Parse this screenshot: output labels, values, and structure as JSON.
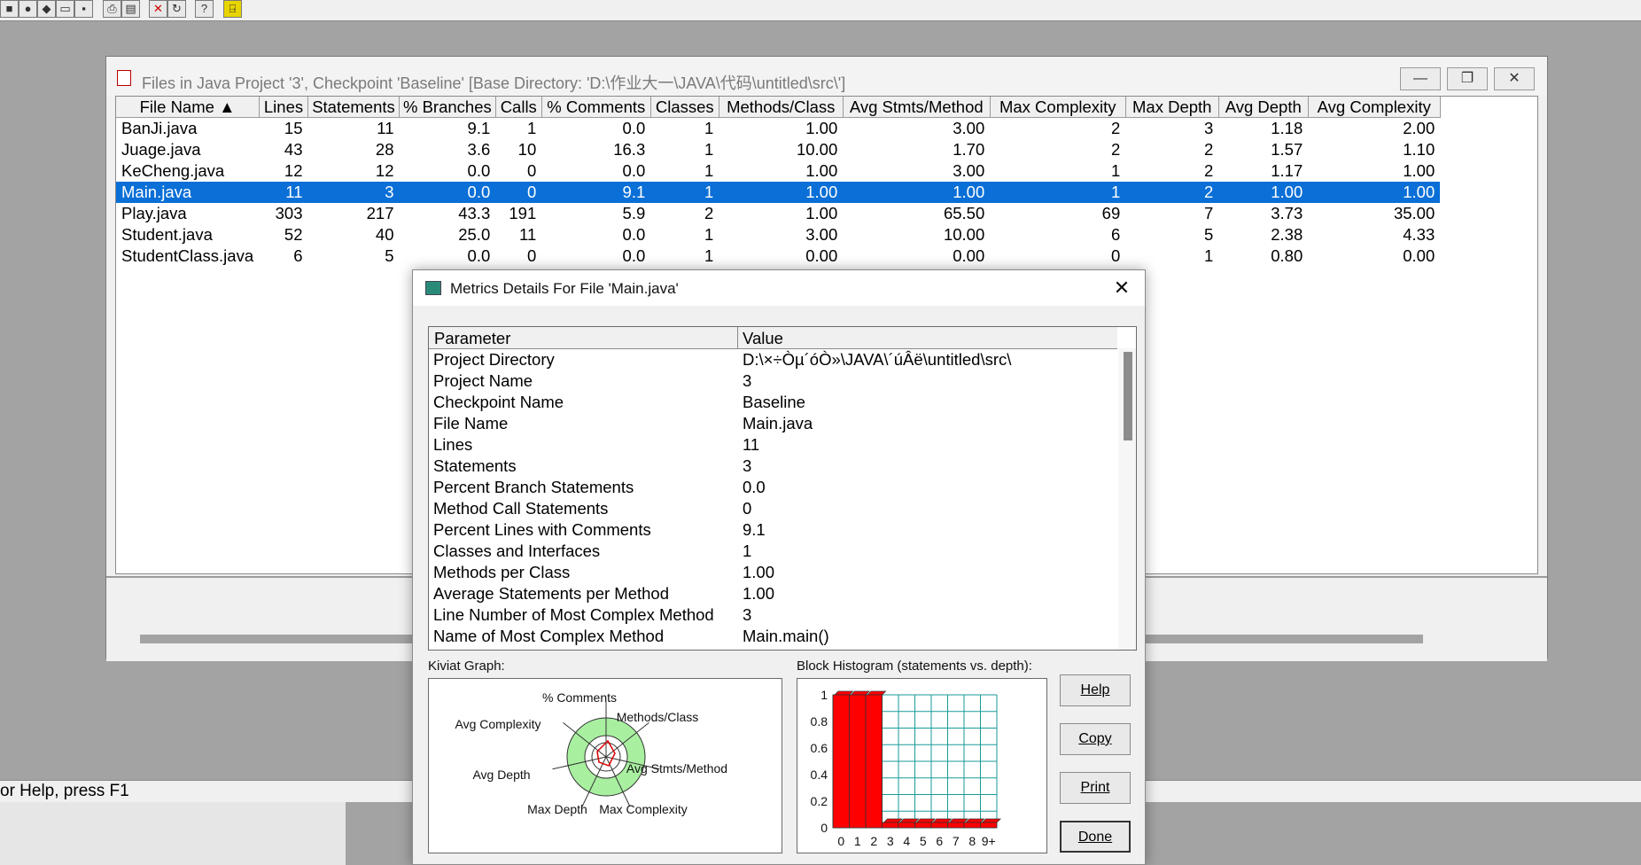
{
  "main_window": {
    "title": "Files in Java Project '3', Checkpoint 'Baseline'  [Base Directory: 'D:\\作业大一\\JAVA\\代码\\untitled\\src\\']",
    "columns": [
      "File Name",
      "Lines",
      "Statements",
      "% Branches",
      "Calls",
      "% Comments",
      "Classes",
      "Methods/Class",
      "Avg Stmts/Method",
      "Max Complexity",
      "Max Depth",
      "Avg Depth",
      "Avg Complexity"
    ],
    "rows": [
      [
        "BanJi.java",
        "15",
        "11",
        "9.1",
        "1",
        "0.0",
        "1",
        "1.00",
        "3.00",
        "2",
        "3",
        "1.18",
        "2.00"
      ],
      [
        "Juage.java",
        "43",
        "28",
        "3.6",
        "10",
        "16.3",
        "1",
        "10.00",
        "1.70",
        "2",
        "2",
        "1.57",
        "1.10"
      ],
      [
        "KeCheng.java",
        "12",
        "12",
        "0.0",
        "0",
        "0.0",
        "1",
        "1.00",
        "3.00",
        "1",
        "2",
        "1.17",
        "1.00"
      ],
      [
        "Main.java",
        "11",
        "3",
        "0.0",
        "0",
        "9.1",
        "1",
        "1.00",
        "1.00",
        "1",
        "2",
        "1.00",
        "1.00"
      ],
      [
        "Play.java",
        "303",
        "217",
        "43.3",
        "191",
        "5.9",
        "2",
        "1.00",
        "65.50",
        "69",
        "7",
        "3.73",
        "35.00"
      ],
      [
        "Student.java",
        "52",
        "40",
        "25.0",
        "11",
        "0.0",
        "1",
        "3.00",
        "10.00",
        "6",
        "5",
        "2.38",
        "4.33"
      ],
      [
        "StudentClass.java",
        "6",
        "5",
        "0.0",
        "0",
        "0.0",
        "1",
        "0.00",
        "0.00",
        "0",
        "1",
        "0.80",
        "0.00"
      ]
    ],
    "selected_row": 3
  },
  "status_bar": {
    "text": "or Help, press F1"
  },
  "dialog": {
    "title": "Metrics Details For File 'Main.java'",
    "close_label": "✕",
    "param_header": "Parameter",
    "value_header": "Value",
    "params": [
      {
        "name": "Project Directory",
        "value": "D:\\×÷Òµ´óÒ»\\JAVA\\´úÂë\\untitled\\src\\"
      },
      {
        "name": "Project Name",
        "value": "3"
      },
      {
        "name": "Checkpoint Name",
        "value": "Baseline"
      },
      {
        "name": "File Name",
        "value": "Main.java"
      },
      {
        "name": "Lines",
        "value": "11"
      },
      {
        "name": "Statements",
        "value": "3"
      },
      {
        "name": "Percent Branch Statements",
        "value": "0.0"
      },
      {
        "name": "Method Call Statements",
        "value": "0"
      },
      {
        "name": "Percent Lines with Comments",
        "value": "9.1"
      },
      {
        "name": "Classes and Interfaces",
        "value": "1"
      },
      {
        "name": "Methods per Class",
        "value": "1.00"
      },
      {
        "name": "Average Statements per Method",
        "value": "1.00"
      },
      {
        "name": "Line Number of Most Complex Method",
        "value": "3"
      },
      {
        "name": "Name of Most Complex Method",
        "value": "Main.main()"
      }
    ],
    "kiviat_label": "Kiviat Graph:",
    "kiviat_axes": [
      "% Comments",
      "Methods/Class",
      "Avg Stmts/Method",
      "Max Complexity",
      "Max Depth",
      "Avg Depth",
      "Avg Complexity"
    ],
    "histogram_label": "Block Histogram (statements vs. depth):",
    "histogram_y_ticks": [
      "1",
      "0.8",
      "0.6",
      "0.4",
      "0.2",
      "0"
    ],
    "histogram_x_ticks": [
      "0",
      "1",
      "2",
      "3",
      "4",
      "5",
      "6",
      "7",
      "8",
      "9+"
    ],
    "histogram_values": [
      1,
      1,
      1,
      0,
      0,
      0,
      0,
      0,
      0,
      0
    ],
    "buttons": {
      "help": "Help",
      "copy": "Copy",
      "print": "Print",
      "done": "Done"
    }
  }
}
